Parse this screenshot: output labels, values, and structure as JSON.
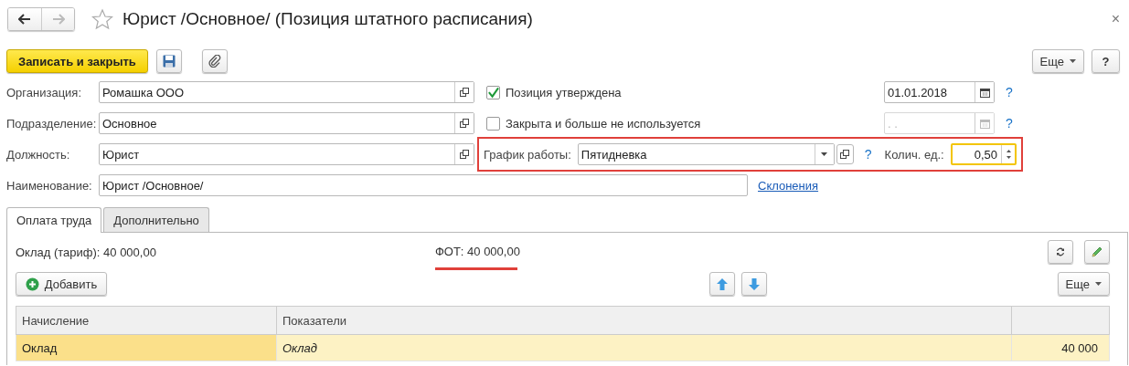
{
  "window": {
    "title": "Юрист /Основное/ (Позиция штатного расписания)",
    "favorite": false,
    "close": "×"
  },
  "nav": {
    "back_enabled": true,
    "forward_enabled": false
  },
  "toolbar": {
    "primary_button": "Записать и закрыть",
    "more_button": "Еще",
    "help_button": "?"
  },
  "fields": [
    {
      "label": "Организация:",
      "value": "Ромашка ООО"
    },
    {
      "label": "Подразделение:",
      "value": "Основное"
    },
    {
      "label": "Должность:",
      "value": "Юрист"
    }
  ],
  "flags": [
    {
      "label": "Позиция утверждена",
      "checked": true
    },
    {
      "label": "Закрыта и больше не используется",
      "checked": false
    }
  ],
  "dates": [
    {
      "value": "01.01.2018",
      "disabled": false,
      "help": "?"
    },
    {
      "placeholder": ".  .",
      "disabled": true,
      "help": "?"
    }
  ],
  "schedule": {
    "label": "График работы:",
    "value": "Пятидневка",
    "help": "?",
    "units_label": "Колич. ед.:",
    "units_value": "0,50",
    "units_focused": true,
    "highlighted": true
  },
  "name_field": {
    "label": "Наименование:",
    "value": "Юрист /Основное/",
    "link": "Склонения"
  },
  "tabs": [
    {
      "label": "Оплата труда",
      "selected": true
    },
    {
      "label": "Дополнительно",
      "selected": false
    }
  ],
  "pay": {
    "salary_label": "Оклад (тариф):",
    "salary_value": "40 000,00",
    "fot_label": "ФОТ:",
    "fot_value": "40 000,00",
    "fot_underlined": true
  },
  "table_toolbar": {
    "add_button": "Добавить",
    "more_button": "Еще"
  },
  "table": {
    "columns": [
      "Начисление",
      "Показатели"
    ],
    "rows": [
      {
        "accrual": "Оклад",
        "indicator": "Оклад",
        "amount": "40 000",
        "selected": true
      }
    ]
  }
}
